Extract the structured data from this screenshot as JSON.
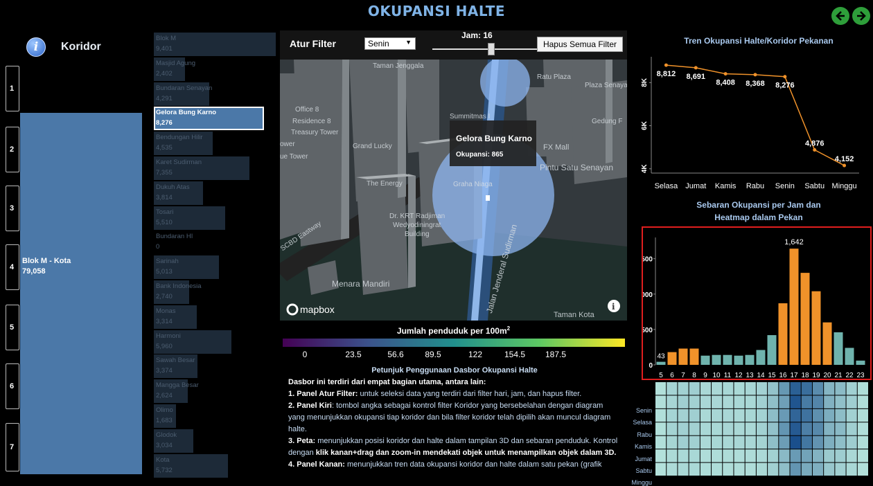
{
  "header": {
    "title": "OKUPANSI HALTE"
  },
  "koridor": {
    "label": "Koridor",
    "buttons": [
      "1",
      "2",
      "3",
      "4",
      "5",
      "6",
      "7"
    ],
    "selected": {
      "name": "Blok M - Kota",
      "value": "79,058"
    }
  },
  "stops": [
    {
      "name": "Blok M",
      "value": "9,401",
      "occ": 9401
    },
    {
      "name": "Masjid Agung",
      "value": "2,402",
      "occ": 2402
    },
    {
      "name": "Bundaran Senayan",
      "value": "4,291",
      "occ": 4291
    },
    {
      "name": "Gelora Bung Karno",
      "value": "8,276",
      "occ": 8276,
      "selected": true
    },
    {
      "name": "Bendungan Hilir",
      "value": "4,535",
      "occ": 4535
    },
    {
      "name": "Karet Sudirman",
      "value": "7,355",
      "occ": 7355
    },
    {
      "name": "Dukuh Atas",
      "value": "3,814",
      "occ": 3814
    },
    {
      "name": "Tosari",
      "value": "5,510",
      "occ": 5510
    },
    {
      "name": "Bundaran HI",
      "value": "0",
      "occ": 0
    },
    {
      "name": "Sarinah",
      "value": "5,013",
      "occ": 5013
    },
    {
      "name": "Bank Indonesia",
      "value": "2,740",
      "occ": 2740
    },
    {
      "name": "Monas",
      "value": "3,314",
      "occ": 3314
    },
    {
      "name": "Harmoni",
      "value": "5,960",
      "occ": 5960
    },
    {
      "name": "Sawah Besar",
      "value": "3,374",
      "occ": 3374
    },
    {
      "name": "Mangga Besar",
      "value": "2,624",
      "occ": 2624
    },
    {
      "name": "Olimo",
      "value": "1,683",
      "occ": 1683
    },
    {
      "name": "Glodok",
      "value": "3,034",
      "occ": 3034
    },
    {
      "name": "Kota",
      "value": "5,732",
      "occ": 5732
    }
  ],
  "filter": {
    "label": "Atur Filter",
    "day": "Senin",
    "day_arrow": "▼",
    "jam_label": "Jam: 16",
    "jam": 16,
    "clear_label": "Hapus Semua Filter"
  },
  "map": {
    "tooltip_title": "Gelora Bung Karno",
    "tooltip_value": "Okupansi: 865",
    "labels": [
      "Taman Jenggala",
      "Office 8",
      "Residence 8",
      "Treasury Tower",
      "Grand Lucky",
      "Summitmas I",
      "FX Mall",
      "Pintu Satu Senayan",
      "The Energy",
      "Graha Niaga",
      "Dr. KRT Radjiman Wedyodiningrat Building",
      "Menara Mandiri",
      "Jalan Jenderal Sudirman",
      "SCBD Eastway",
      "Taman Kota",
      "Ratu Plaza",
      "Plaza Senayan",
      "Gedung F",
      "ue Tower",
      "ower"
    ],
    "brand": "mapbox",
    "info": "i"
  },
  "colorbar": {
    "title": "Jumlah penduduk per 100m",
    "sup": "2",
    "ticks": [
      "0",
      "23.5",
      "56.6",
      "89.5",
      "122",
      "154.5",
      "187.5"
    ]
  },
  "instructions": {
    "heading": "Petunjuk Penggunaan Dasbor Okupansi Halte",
    "intro": "Dasbor ini terdiri dari empat bagian utama, antara lain:",
    "items": [
      {
        "b": "1. Panel Atur Filter:",
        "t": " untuk seleksi data yang terdiri dari filter hari, jam, dan hapus filter."
      },
      {
        "b": "2. Panel Kiri",
        "t": ": tombol angka sebagai kontrol filter Koridor yang bersebelahan dengan diagram yang menunjukkan okupansi tiap koridor dan bila filter koridor telah dipilih akan muncul diagram halte."
      },
      {
        "b": "3. Peta:",
        "t": " menunjukkan posisi koridor dan halte dalam tampilan 3D dan sebaran penduduk. Kontrol dengan ",
        "b2": "klik kanan+drag dan zoom-in mendekati objek untuk menampilkan objek dalam 3D."
      },
      {
        "b": "4. Panel Kanan:",
        "t": " menunjukkan tren data okupansi koridor dan halte dalam satu pekan (grafik"
      }
    ]
  },
  "chart_data": [
    {
      "type": "line",
      "title": "Tren Okupansi Halte/Koridor Pekanan",
      "categories": [
        "Selasa",
        "Jumat",
        "Kamis",
        "Rabu",
        "Senin",
        "Sabtu",
        "Minggu"
      ],
      "values": [
        8812,
        8691,
        8408,
        8368,
        8276,
        4876,
        4152
      ],
      "labels": [
        "8,812",
        "8,691",
        "8,408",
        "8,368",
        "8,276",
        "4,876",
        "4,152"
      ],
      "yticks": [
        "4K",
        "6K",
        "8K"
      ],
      "ylim": [
        3800,
        9200
      ],
      "color": "#f0922a"
    },
    {
      "type": "bar",
      "title": "Sebaran Okupansi per Jam dan Heatmap dalam Pekan",
      "categories": [
        "5",
        "6",
        "7",
        "8",
        "9",
        "10",
        "11",
        "12",
        "13",
        "14",
        "15",
        "16",
        "17",
        "18",
        "19",
        "20",
        "21",
        "22",
        "23"
      ],
      "values": [
        43,
        180,
        230,
        230,
        130,
        140,
        140,
        130,
        140,
        210,
        420,
        870,
        1642,
        1300,
        1040,
        600,
        460,
        240,
        60
      ],
      "peak_label": "1,642",
      "first_label": "43",
      "yticks": [
        "0",
        "500",
        "1000",
        "1500"
      ],
      "ylim": [
        0,
        1800
      ],
      "highlight_color": "#f0922a",
      "base_color": "#6fb3ad",
      "highlight_hours": [
        "6",
        "7",
        "8",
        "16",
        "17",
        "18",
        "19",
        "20"
      ]
    },
    {
      "type": "heatmap",
      "rows": [
        "Senin",
        "Selasa",
        "Rabu",
        "Kamis",
        "Jumat",
        "Sabtu",
        "Minggu"
      ],
      "columns": [
        "5",
        "6",
        "7",
        "8",
        "9",
        "10",
        "11",
        "12",
        "13",
        "14",
        "15",
        "16",
        "17",
        "18",
        "19",
        "20",
        "21",
        "22",
        "23"
      ],
      "colors": [
        "#b5e3dc",
        "#2a6fa8",
        "#1a4f8c"
      ]
    }
  ]
}
